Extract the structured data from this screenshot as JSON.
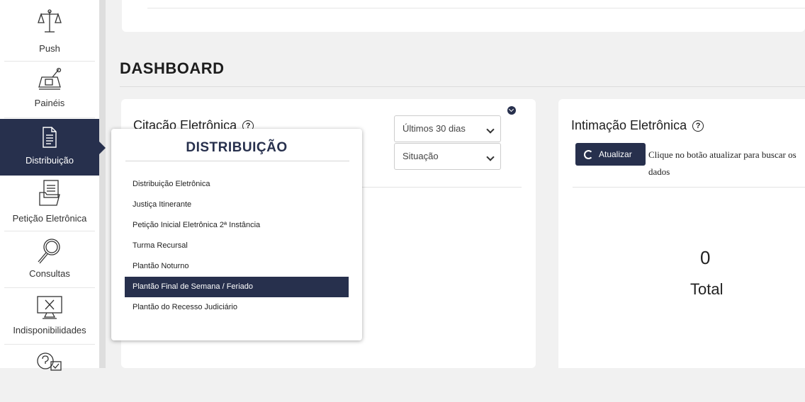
{
  "sidebar": {
    "items": [
      {
        "label": "Push",
        "icon": "scales-icon"
      },
      {
        "label": "Painéis",
        "icon": "panel-icon"
      },
      {
        "label": "Distribuição",
        "icon": "document-icon",
        "active": true
      },
      {
        "label": "Petição Eletrônica",
        "icon": "files-icon"
      },
      {
        "label": "Consultas",
        "icon": "magnifier-icon"
      },
      {
        "label": "Indisponibilidades",
        "icon": "monitor-x-icon"
      },
      {
        "label": "",
        "icon": "help-check-icon"
      }
    ]
  },
  "dashboard": {
    "title": "DASHBOARD"
  },
  "citacao": {
    "title": "Citação Eletrônica",
    "period_select": "Últimos 30 dias",
    "situacao_select": "Situação"
  },
  "intimacao": {
    "title": "Intimação Eletrônica",
    "refresh_button": "Atualizar",
    "hint": "Clique no botão atualizar para buscar os dados",
    "total_value": "0",
    "total_label": "Total"
  },
  "distribuicao_menu": {
    "title": "DISTRIBUIÇÃO",
    "items": [
      "Distribuição Eletrônica",
      "Justiça Itinerante",
      "Petição Inicial Eletrônica 2ª Instância",
      "Turma Recursal",
      "Plantão Noturno",
      "Plantão Final de Semana / Feriado",
      "Plantão do Recesso Judiciário"
    ],
    "highlighted_index": 5
  },
  "colors": {
    "primary": "#27304d",
    "background": "#f1f1f1"
  }
}
